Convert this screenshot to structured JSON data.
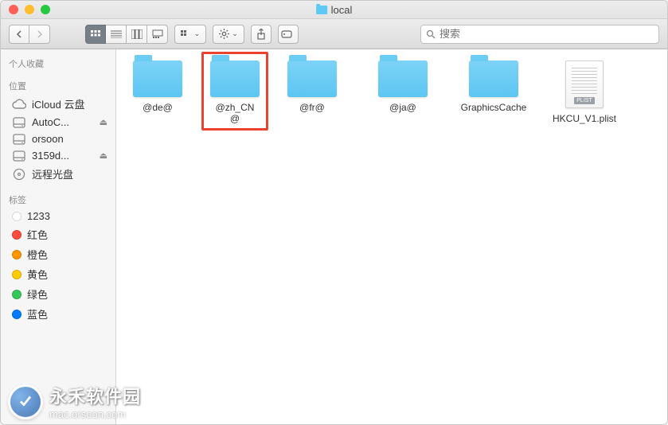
{
  "window": {
    "title": "local"
  },
  "search": {
    "placeholder": "搜索"
  },
  "sidebar": {
    "favorites_head": "个人收藏",
    "locations_head": "位置",
    "tags_head": "标签",
    "locations": [
      {
        "label": "iCloud 云盘",
        "icon": "cloud",
        "eject": false
      },
      {
        "label": "AutoC...",
        "icon": "drive",
        "eject": true
      },
      {
        "label": "orsoon",
        "icon": "drive",
        "eject": false
      },
      {
        "label": "3159d...",
        "icon": "drive",
        "eject": true
      },
      {
        "label": "远程光盘",
        "icon": "disc",
        "eject": false
      }
    ],
    "tags": [
      {
        "label": "1233",
        "color": "#ffffff"
      },
      {
        "label": "红色",
        "color": "#ff4b3e"
      },
      {
        "label": "橙色",
        "color": "#ff9500"
      },
      {
        "label": "黄色",
        "color": "#ffcc00"
      },
      {
        "label": "绿色",
        "color": "#34c759"
      },
      {
        "label": "蓝色",
        "color": "#007aff"
      }
    ]
  },
  "items": {
    "folders": [
      {
        "label": "@de@",
        "highlight": false
      },
      {
        "label": "@zh_CN@",
        "highlight": true
      },
      {
        "label": "@fr@",
        "highlight": false
      },
      {
        "label": "@ja@",
        "highlight": false
      },
      {
        "label": "GraphicsCache",
        "highlight": false
      }
    ],
    "files": [
      {
        "label": "HKCU_V1.plist",
        "badge": "PLIST"
      }
    ]
  },
  "watermark": {
    "text": "永禾软件园",
    "sub": "mac.orsoon.com"
  }
}
